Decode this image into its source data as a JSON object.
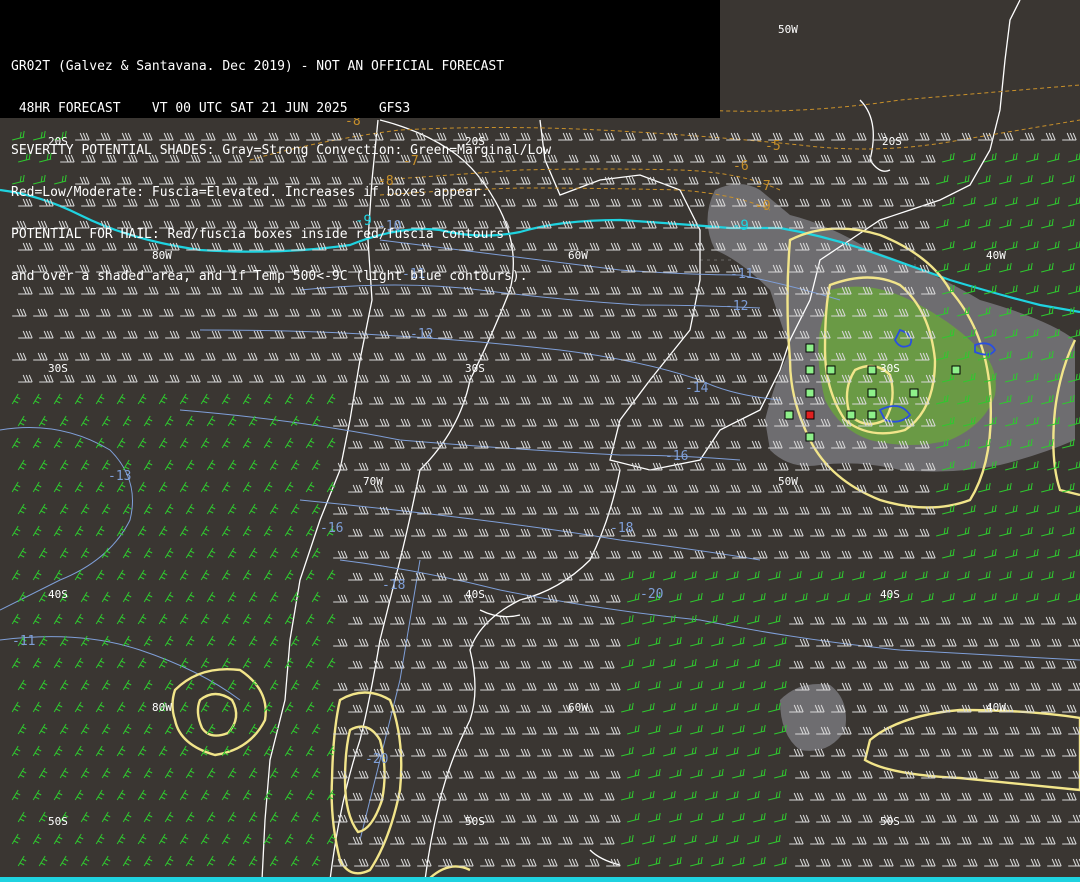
{
  "header": {
    "lines": [
      "GR02T (Galvez & Santavana. Dec 2019) - NOT AN OFFICIAL FORECAST",
      " 48HR FORECAST    VT 00 UTC SAT 21 JUN 2025    GFS3",
      "SEVERITY POTENTIAL SHADES: Gray=Strong Convection: Green=Marginal/Low",
      "Red=Low/Moderate: Fuscia=Elevated. Increases if boxes appear.",
      "POTENTIAL FOR HAIL: Red/fuscia boxes inside red/fuscia contours",
      "and over a shaded area, and if Temp 500<-9C (light blue contours)."
    ]
  },
  "grid_labels": [
    {
      "text": "50W"
    },
    {
      "text": "20S"
    },
    {
      "text": "20S"
    },
    {
      "text": "20S"
    },
    {
      "text": "80W"
    },
    {
      "text": "60W"
    },
    {
      "text": "40W"
    },
    {
      "text": "30S"
    },
    {
      "text": "30S"
    },
    {
      "text": "30S"
    },
    {
      "text": "70W"
    },
    {
      "text": "50W"
    },
    {
      "text": "40S"
    },
    {
      "text": "40S"
    },
    {
      "text": "40S"
    },
    {
      "text": "80W"
    },
    {
      "text": "60W"
    },
    {
      "text": "40W"
    },
    {
      "text": "50S"
    },
    {
      "text": "50S"
    },
    {
      "text": "50S"
    }
  ],
  "temp_labels_light_blue": [
    {
      "text": "-10"
    },
    {
      "text": "-11"
    },
    {
      "text": "-11"
    },
    {
      "text": "-12"
    },
    {
      "text": "-12"
    },
    {
      "text": "-13"
    },
    {
      "text": "-14"
    },
    {
      "text": "-16"
    },
    {
      "text": "-16"
    },
    {
      "text": "-18"
    },
    {
      "text": "-18"
    },
    {
      "text": "-20"
    },
    {
      "text": "-11"
    },
    {
      "text": "-20"
    }
  ],
  "temp_labels_orange": [
    {
      "text": "-5"
    },
    {
      "text": "-6"
    },
    {
      "text": "-7"
    },
    {
      "text": "-7"
    },
    {
      "text": "-8"
    },
    {
      "text": "-8"
    },
    {
      "text": "-9"
    }
  ],
  "temp_labels_cyan": [
    {
      "text": "-9"
    },
    {
      "text": "-9"
    }
  ],
  "colors": {
    "background": "#3a3632",
    "coastline": "#ffffff",
    "cyan_contour": "#1fd3e0",
    "light_blue_contour": "#7f9fd8",
    "orange_contour": "#c8902a",
    "yellow_contour": "#f2e58a",
    "gray_shade": "#6e6d70",
    "green_shade": "#6a9a45",
    "blue_contour": "#2a4fe0",
    "green_box": "#8ef08a",
    "red_box": "#e02020",
    "wind_white": "#d8d8d8",
    "wind_green": "#2fc82f"
  },
  "hail_boxes": [
    {
      "color": "green"
    },
    {
      "color": "green"
    },
    {
      "color": "green"
    },
    {
      "color": "green"
    },
    {
      "color": "green"
    },
    {
      "color": "green"
    },
    {
      "color": "green"
    },
    {
      "color": "green"
    },
    {
      "color": "red"
    },
    {
      "color": "green"
    },
    {
      "color": "green"
    },
    {
      "color": "green"
    },
    {
      "color": "green"
    },
    {
      "color": "green"
    }
  ],
  "icons": {
    "wind_barb": "wind-barb-icon",
    "hail_box": "hail-box-icon"
  }
}
